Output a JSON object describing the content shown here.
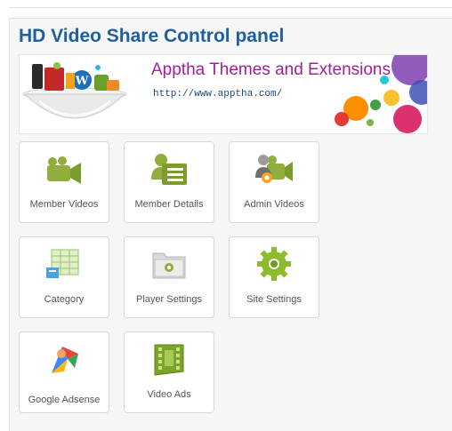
{
  "panel": {
    "title": "HD Video Share Control panel"
  },
  "banner": {
    "title": "Apptha Themes and Extensions",
    "url": "http://www.apptha.com/"
  },
  "tiles": [
    {
      "label": "Member Videos",
      "icon": "member-videos-icon"
    },
    {
      "label": "Member Details",
      "icon": "member-details-icon"
    },
    {
      "label": "Admin Videos",
      "icon": "admin-videos-icon"
    },
    {
      "label": "Category",
      "icon": "category-icon"
    },
    {
      "label": "Player Settings",
      "icon": "player-settings-icon"
    },
    {
      "label": "Site Settings",
      "icon": "site-settings-icon"
    },
    {
      "label": "Google Adsense",
      "icon": "google-adsense-icon"
    },
    {
      "label": "Video Ads",
      "icon": "video-ads-icon"
    }
  ]
}
